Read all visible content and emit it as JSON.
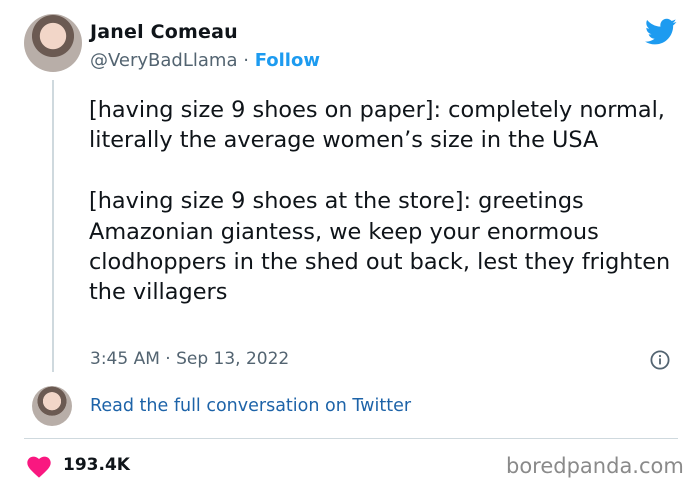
{
  "author": {
    "name": "Janel Comeau",
    "handle": "@VeryBadLlama",
    "separator": "·",
    "follow_label": "Follow"
  },
  "tweet": {
    "text": "[having size 9 shoes on paper]: completely normal, literally the average women’s size in the USA\n\n[having size 9 shoes at the store]: greetings Amazonian giantess, we keep your enormous clodhoppers in the shed out back, lest they frighten the villagers",
    "timestamp": "3:45 AM · Sep 13, 2022"
  },
  "conversation_link": "Read the full conversation on Twitter",
  "likes": "193.4K",
  "watermark": "boredpanda.com",
  "icons": {
    "brand": "twitter-bird-icon",
    "info": "info-icon",
    "like": "heart-icon"
  },
  "colors": {
    "twitter_blue": "#1d9bf0",
    "link_blue": "#1d63a8",
    "heart": "#f91880",
    "secondary_text": "#536471"
  }
}
